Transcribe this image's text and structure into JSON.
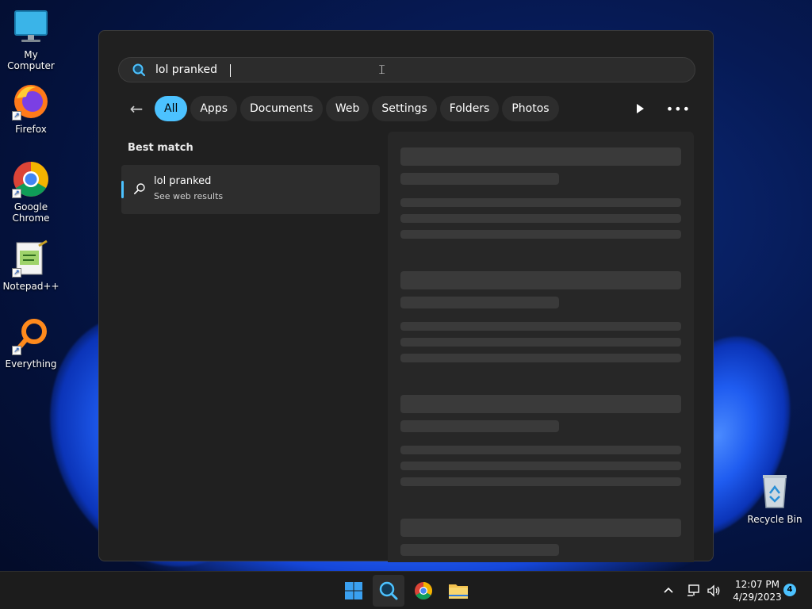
{
  "desktop": {
    "icons": [
      {
        "label": "My Computer"
      },
      {
        "label": "Firefox"
      },
      {
        "label": "Google Chrome"
      },
      {
        "label": "Notepad++"
      },
      {
        "label": "Everything"
      },
      {
        "label": "Recycle Bin"
      }
    ]
  },
  "search": {
    "query": "lol pranked",
    "filters": [
      "All",
      "Apps",
      "Documents",
      "Web",
      "Settings",
      "Folders",
      "Photos"
    ],
    "active_filter": "All",
    "best_match_label": "Best match",
    "result": {
      "title": "lol pranked",
      "subtitle": "See web results"
    }
  },
  "taskbar": {
    "time": "12:07 PM",
    "date": "4/29/2023",
    "notification_count": "4"
  },
  "colors": {
    "accent": "#4cc2ff",
    "panel_bg": "#202020",
    "taskbar_bg": "#1c1c1c"
  }
}
